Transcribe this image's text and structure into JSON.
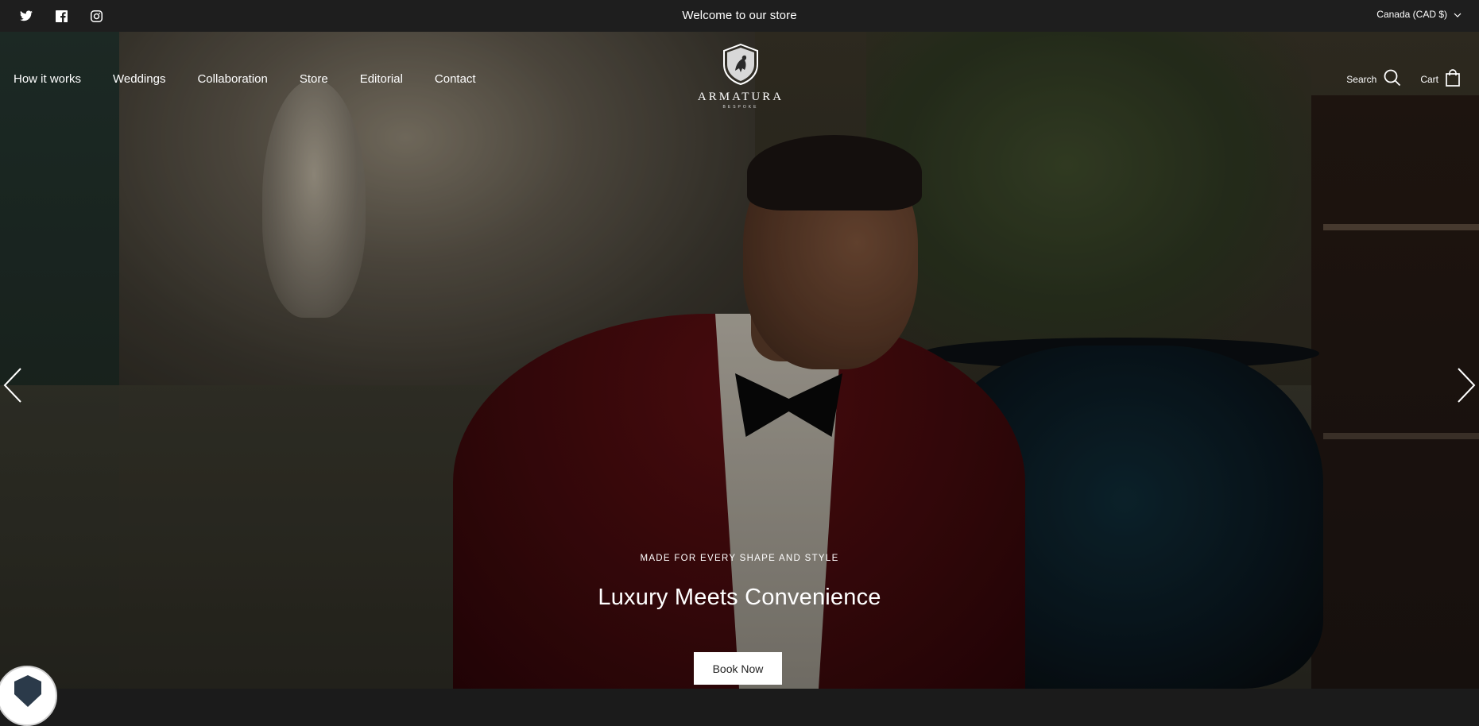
{
  "topbar": {
    "announcement": "Welcome to our store",
    "currency": "Canada (CAD $)",
    "socials": [
      {
        "icon": "twitter-icon"
      },
      {
        "icon": "facebook-icon"
      },
      {
        "icon": "instagram-icon"
      }
    ]
  },
  "header": {
    "nav": [
      {
        "label": "How it works"
      },
      {
        "label": "Weddings"
      },
      {
        "label": "Collaboration"
      },
      {
        "label": "Store"
      },
      {
        "label": "Editorial"
      },
      {
        "label": "Contact"
      }
    ],
    "logo": {
      "wordmark": "ARMATURA",
      "sub": "BESPOKE"
    },
    "search_label": "Search",
    "cart_label": "Cart"
  },
  "hero": {
    "subtitle": "MADE FOR EVERY SHAPE AND STYLE",
    "title": "Luxury Meets Convenience",
    "cta_label": "Book Now"
  },
  "colors": {
    "topbar_bg": "#1e1e1e",
    "text": "#ffffff",
    "cta_bg": "#ffffff",
    "cta_text": "#222222"
  }
}
